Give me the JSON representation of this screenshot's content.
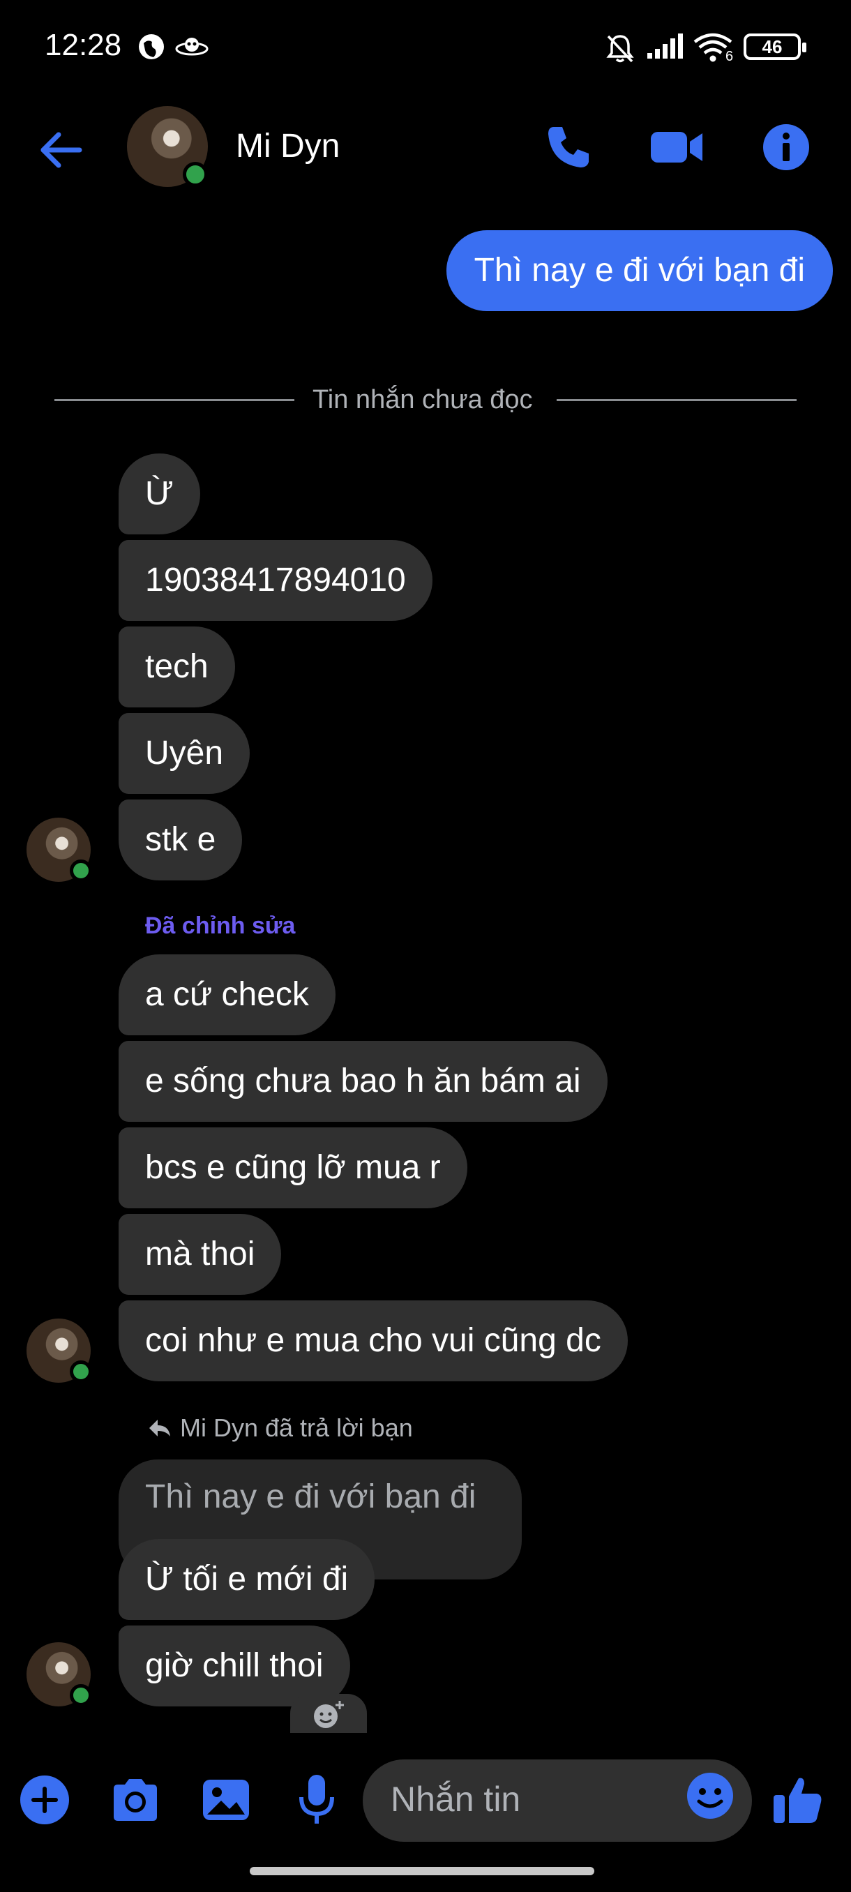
{
  "status_bar": {
    "time": "12:28",
    "battery": "46",
    "signal_label": "6",
    "icons": [
      "vpn-icon",
      "alien-icon",
      "muted-bell-icon",
      "signal-icon",
      "wifi-icon",
      "battery-icon"
    ]
  },
  "header": {
    "contact_name": "Mi Dyn",
    "online": true,
    "actions": [
      "back-arrow-icon",
      "phone-icon",
      "video-icon",
      "info-icon"
    ]
  },
  "conversation": {
    "sent": [
      {
        "text": "Thì nay e đi với bạn đi"
      }
    ],
    "unread_divider": "Tin nhắn chưa đọc",
    "group1": [
      "Ừ",
      "19038417894010",
      "tech",
      "Uyên",
      "stk e"
    ],
    "edited_label": "Đã chỉnh sửa",
    "group2": [
      "a cứ check",
      "e sống chưa bao h ăn bám ai",
      "bcs e cũng lỡ mua r",
      "mà thoi",
      "coi như e mua cho vui cũng dc"
    ],
    "reply_label": "Mi Dyn đã trả lời bạn",
    "quoted_text": "Thì nay e đi với bạn đi",
    "group3": [
      "Ừ tối e mới đi",
      "giờ chill thoi"
    ]
  },
  "composer": {
    "placeholder": "Nhắn tin",
    "icons": [
      "plus-icon",
      "camera-icon",
      "image-icon",
      "microphone-icon",
      "emoji-icon",
      "thumbs-up-icon"
    ]
  },
  "colors": {
    "accent": "#3a6ff2",
    "bubble_received": "#303030",
    "online": "#31a24c",
    "edited": "#6d5cf0"
  }
}
